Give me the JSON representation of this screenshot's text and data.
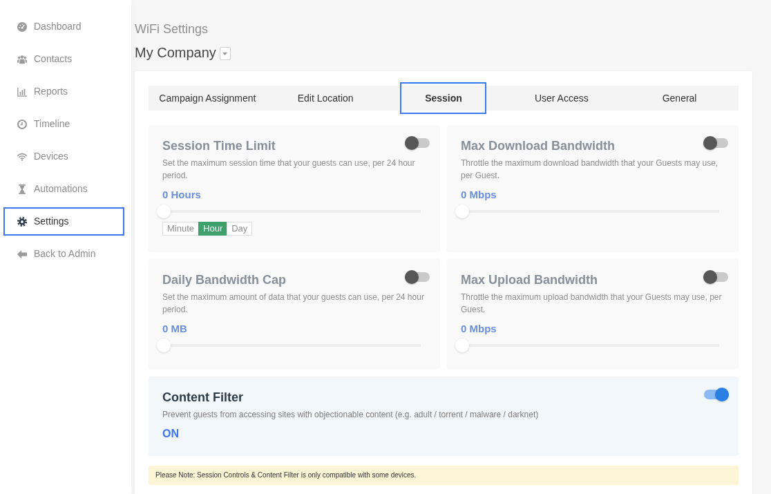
{
  "sidebar": {
    "items": [
      {
        "label": "Dashboard",
        "selected": false
      },
      {
        "label": "Contacts",
        "selected": false
      },
      {
        "label": "Reports",
        "selected": false
      },
      {
        "label": "Timeline",
        "selected": false
      },
      {
        "label": "Devices",
        "selected": false
      },
      {
        "label": "Automations",
        "selected": false
      },
      {
        "label": "Settings",
        "selected": true
      },
      {
        "label": "Back to Admin",
        "selected": false
      }
    ]
  },
  "header": {
    "title": "WiFi Settings",
    "location": "My Company"
  },
  "tabs": [
    {
      "label": "Campaign Assignment",
      "selected": false
    },
    {
      "label": "Edit Location",
      "selected": false
    },
    {
      "label": "Session",
      "selected": true
    },
    {
      "label": "User Access",
      "selected": false
    },
    {
      "label": "General",
      "selected": false
    }
  ],
  "panels": [
    {
      "title": "Session Time Limit",
      "description": "Set the maximum session time that your guests can use, per 24 hour period.",
      "enabled": false,
      "value": "0 Hours",
      "level": 0,
      "units": [
        {
          "label": "Minute",
          "selected": false
        },
        {
          "label": "Hour",
          "selected": true
        },
        {
          "label": "Day",
          "selected": false
        }
      ]
    },
    {
      "title": "Max Download Bandwidth",
      "description": "Throttle the maximum download bandwidth that your Guests may use, per Guest.",
      "enabled": false,
      "value": "0 Mbps",
      "level": 0
    },
    {
      "title": "Daily Bandwidth Cap",
      "description": "Set the maximum amount of data that your guests can use, per 24 hour period.",
      "enabled": false,
      "value": "0 MB",
      "level": 0
    },
    {
      "title": "Max Upload Bandwidth",
      "description": "Throttle the maximum upload bandwidth that your Guests may use, per Guest.",
      "enabled": false,
      "value": "0 Mbps",
      "level": 0
    }
  ],
  "content_filter": {
    "title": "Content Filter",
    "description": "Prevent guests from accessing sites with objectionable content (e.g. adult / torrent / malware / darknet)",
    "enabled": true,
    "status": "ON"
  },
  "note": "Please Note: Session Controls & Content Filter is only compatible with some devices."
}
